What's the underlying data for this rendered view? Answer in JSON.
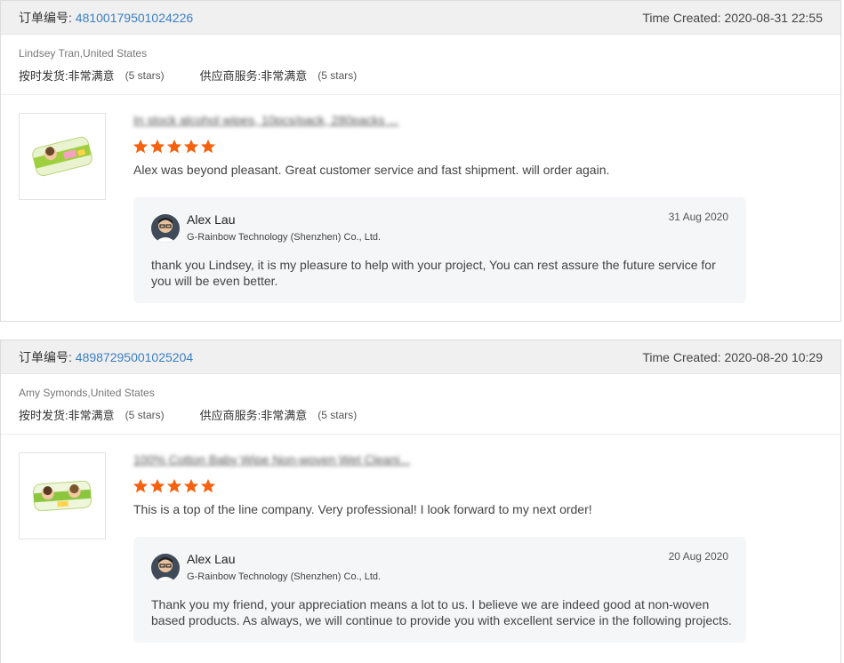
{
  "labels": {
    "order_number": "订单编号:",
    "time_created": "Time Created:",
    "on_time_shipping": "按时发货:",
    "supplier_service": "供应商服务:",
    "very_satisfied": "非常满意",
    "five_stars": "(5 stars)"
  },
  "colors": {
    "star": "#f5620f",
    "link": "#3a7fc4",
    "header_bg": "#f0f0f0",
    "reply_bg": "#f5f6f8"
  },
  "reviews": [
    {
      "order_number": "48100179501024226",
      "time_created": "2020-08-31 22:55",
      "buyer": "Lindsey Tran,United States",
      "product_title": "In stock alcohol wipes, 10pcs/pack, 280packs ...",
      "rating": 5,
      "comment": "Alex was beyond pleasant. Great customer service and fast shipment. will order again.",
      "reply": {
        "name": "Alex Lau",
        "company": "G-Rainbow Technology (Shenzhen) Co., Ltd.",
        "date": "31 Aug 2020",
        "text": "thank you Lindsey, it is my pleasure to help with your project, You can rest assure the future service for you will be even better."
      }
    },
    {
      "order_number": "48987295001025204",
      "time_created": "2020-08-20 10:29",
      "buyer": "Amy Symonds,United States",
      "product_title": "100% Cotton Baby Wipe Non-woven Wet Cleani...",
      "rating": 5,
      "comment": "This is a top of the line company.  Very professional!  I look forward to my next order!",
      "reply": {
        "name": "Alex Lau",
        "company": "G-Rainbow Technology (Shenzhen) Co., Ltd.",
        "date": "20 Aug 2020",
        "text": "Thank you my friend, your appreciation means a lot to us. I believe we are indeed good at non-woven based products.  As always, we will continue to provide you with excellent service in the following projects."
      }
    }
  ]
}
